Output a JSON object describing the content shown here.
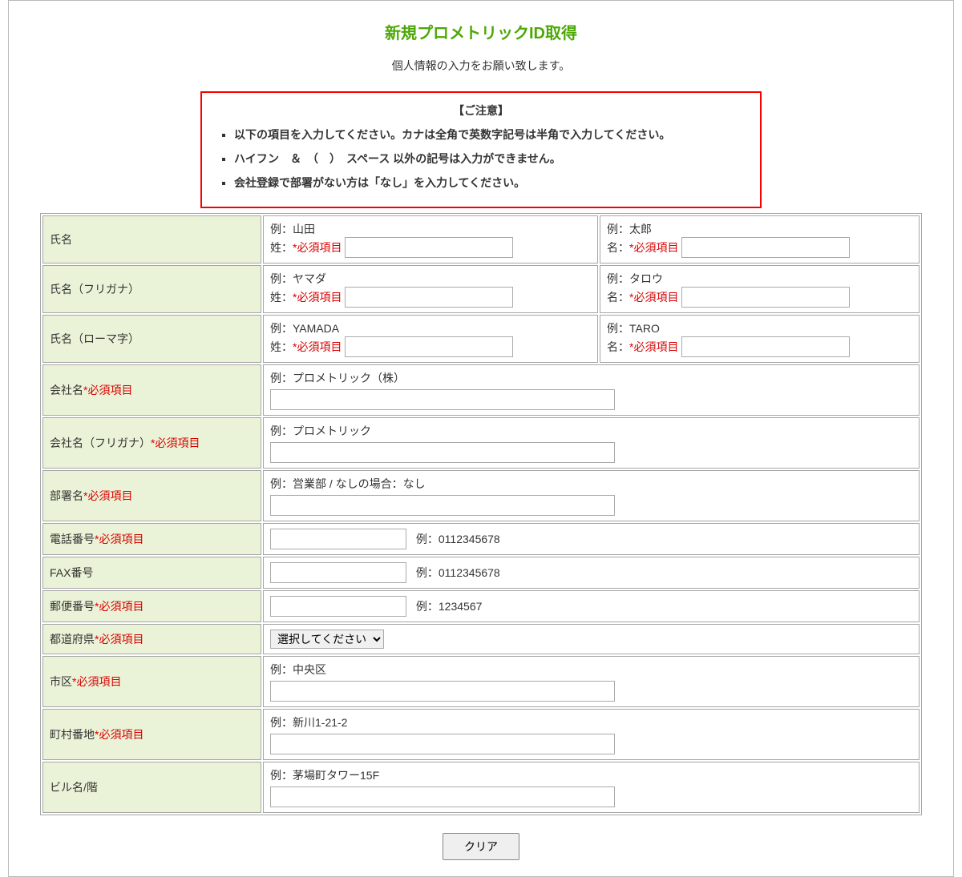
{
  "title": "新規プロメトリックID取得",
  "intro": "個人情報の入力をお願い致します。",
  "notice": {
    "header": "【ご注意】",
    "items": [
      "以下の項目を入力してください。カナは全角で英数字記号は半角で入力してください。",
      "ハイフン　＆　（　）　スペース 以外の記号は入力ができません。",
      "会社登録で部署がない方は「なし」を入力してください。"
    ]
  },
  "labels": {
    "required": "*必須項目",
    "surname_prefix": "姓：",
    "given_prefix": "名：",
    "name": "氏名",
    "kana": "氏名（フリガナ）",
    "roman": "氏名（ローマ字）",
    "company": "会社名",
    "company_kana": "会社名（フリガナ）",
    "department": "部署名",
    "tel": "電話番号",
    "fax": "FAX番号",
    "postal": "郵便番号",
    "prefecture": "都道府県",
    "city": "市区",
    "street": "町村番地",
    "building": "ビル名/階"
  },
  "examples": {
    "name_sur": "例：山田",
    "name_giv": "例：太郎",
    "kana_sur": "例：ヤマダ",
    "kana_giv": "例：タロウ",
    "roman_sur": "例：YAMADA",
    "roman_giv": "例：TARO",
    "company": "例：プロメトリック（株）",
    "company_kana": "例：プロメトリック",
    "department": "例：営業部 / なしの場合：なし",
    "tel": "例：0112345678",
    "fax": "例：0112345678",
    "postal": "例：1234567",
    "city": "例：中央区",
    "street": "例：新川1-21-2",
    "building": "例：茅場町タワー15F"
  },
  "prefecture_placeholder": "選択してください",
  "buttons": {
    "clear": "クリア"
  }
}
